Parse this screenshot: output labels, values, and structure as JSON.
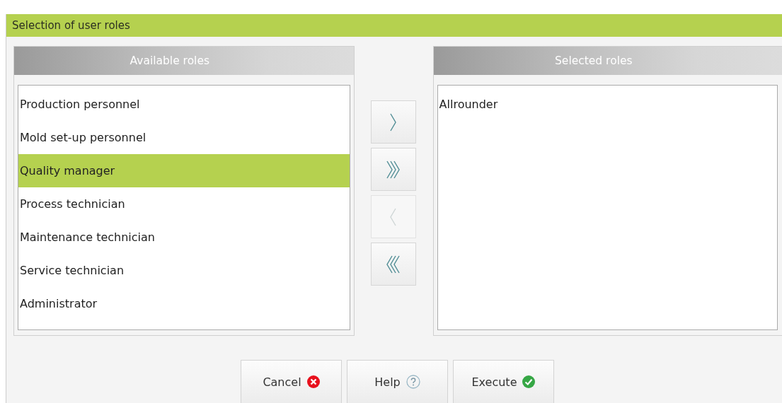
{
  "window": {
    "title": "Selection of user roles"
  },
  "available": {
    "heading": "Available roles",
    "items": [
      {
        "label": "Production personnel",
        "selected": false
      },
      {
        "label": "Mold set-up personnel",
        "selected": false
      },
      {
        "label": "Quality manager",
        "selected": true
      },
      {
        "label": "Process technician",
        "selected": false
      },
      {
        "label": "Maintenance technician",
        "selected": false
      },
      {
        "label": "Service technician",
        "selected": false
      },
      {
        "label": "Administrator",
        "selected": false
      }
    ]
  },
  "move_buttons": [
    {
      "kind": "add",
      "disabled": false
    },
    {
      "kind": "add_all",
      "disabled": false
    },
    {
      "kind": "remove",
      "disabled": true
    },
    {
      "kind": "remove_all",
      "disabled": false
    }
  ],
  "selected": {
    "heading": "Selected roles",
    "items": [
      {
        "label": "Allrounder",
        "selected": false
      }
    ]
  },
  "buttons": [
    {
      "label": "Cancel",
      "kind": "cancel"
    },
    {
      "label": "Help",
      "kind": "help"
    },
    {
      "label": "Execute",
      "kind": "execute"
    }
  ]
}
